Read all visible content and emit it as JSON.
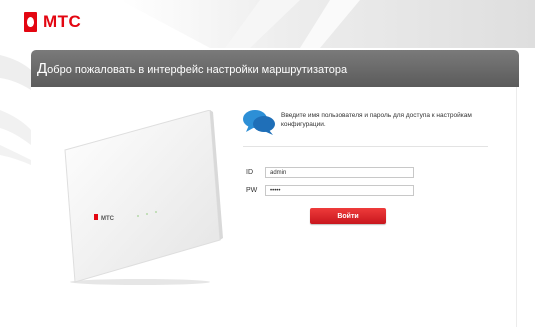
{
  "brand": {
    "logo_text": "МТС",
    "color": "#e30611"
  },
  "header": {
    "title_first": "Д",
    "title_rest": "обро пожаловать в интерфейс настройки маршрутизатора"
  },
  "device": {
    "label": "МТС"
  },
  "info": {
    "icon": "chat-bubbles-icon",
    "text": "Введите имя пользователя и пароль для доступа к настройкам конфигурации."
  },
  "form": {
    "id_label": "ID",
    "id_value": "admin",
    "pw_label": "PW",
    "pw_value": "•••••",
    "login_label": "Войти"
  },
  "colors": {
    "header_bg": "#666666",
    "button": "#d9232b",
    "accent_blue": "#2d8fd6"
  }
}
